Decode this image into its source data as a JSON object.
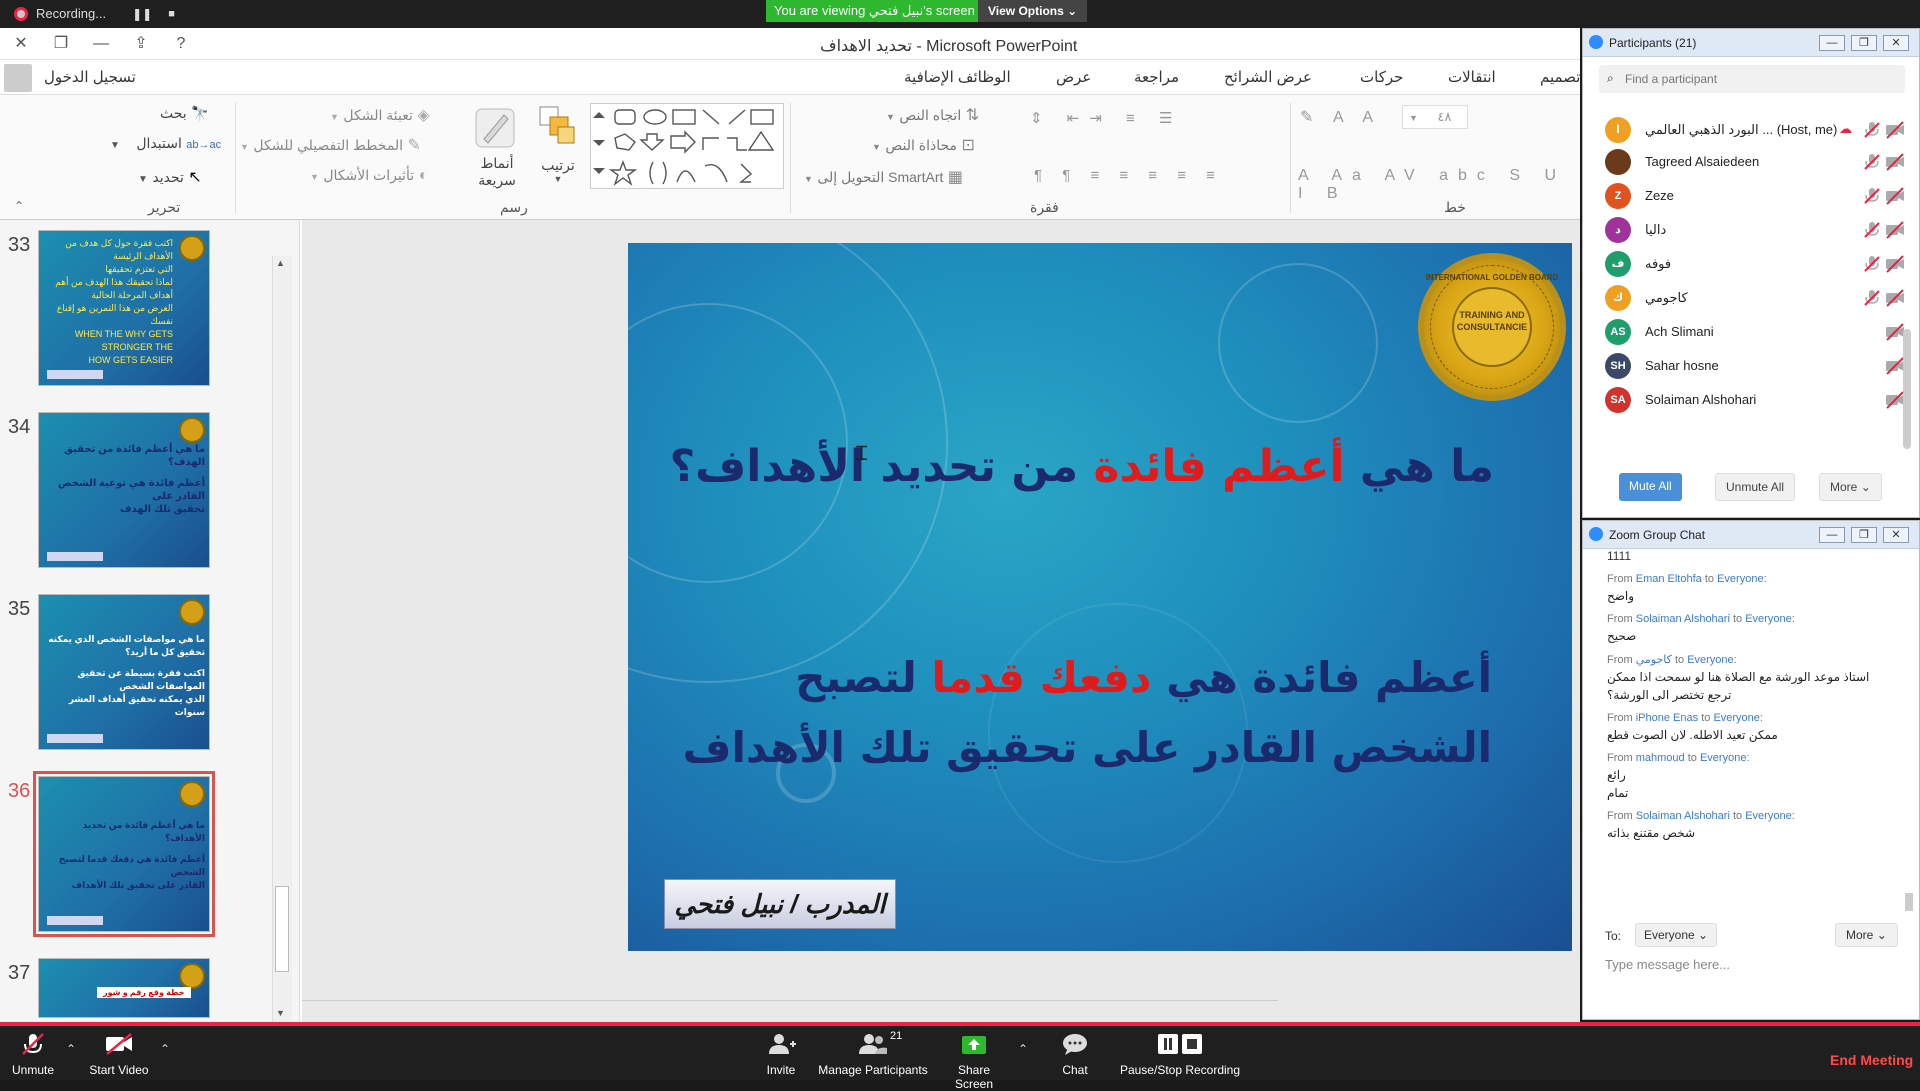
{
  "zoom_top": {
    "recording_label": "Recording...",
    "viewing_banner": "You are viewing نبيل فتحي's screen",
    "view_options": "View Options"
  },
  "ppt": {
    "window_title": "تحديد الاهداف - Microsoft PowerPoint",
    "signin": "تسجيل الدخول",
    "tabs": [
      "تصميم",
      "انتقالات",
      "حركات",
      "عرض الشرائح",
      "مراجعة",
      "عرض",
      "الوظائف الإضافية"
    ],
    "groups": {
      "editing": "تحرير",
      "drawing": "رسم",
      "paragraph": "فقرة",
      "font": "خط"
    },
    "ribbon": {
      "find": "بحث",
      "replace": "استبدال",
      "select": "تحديد",
      "shape_fill": "تعبئة الشكل",
      "shape_outline": "المخطط التفصيلي للشكل",
      "shape_effects": "تأثيرات الأشكال",
      "quick_styles_1": "أنماط",
      "quick_styles_2": "سريعة",
      "arrange": "ترتيب",
      "text_direction": "اتجاه النص",
      "align_text": "محاذاة النص",
      "convert_smartart": "التحويل إلى SmartArt",
      "font_size_value": "٤٨"
    }
  },
  "thumbnails": [
    {
      "num": "33",
      "lines": [
        "اكتب فقرة حول كل هدف من الأهداف الرئيسة",
        "التي تعتزم تحقيقها",
        "لماذا تحقيقك هذا الهدف من أهم",
        "أهداف المرحلة الحالية",
        "",
        "الغرض من هذا التمرين هو إقناع نفسك",
        "WHEN THE WHY GETS STRONGER THE",
        "HOW GETS EASIER"
      ]
    },
    {
      "num": "34",
      "lines": [
        "ما هي أعظم فائدة من تحقيق",
        "الهدف؟",
        "",
        "أعظم فائدة هي توعية الشخص",
        "القادر على",
        "تحقيق تلك الهدف"
      ]
    },
    {
      "num": "35",
      "lines": [
        "ما هي مواصفات الشخص الذي يمكنه",
        "تحقيق كل ما أريد؟",
        "",
        "اكتب فقرة بسيطة عن تحقيق المواصفات الشخص",
        "الذي يمكنه تحقيق أهداف العشر سنوات"
      ]
    },
    {
      "num": "36",
      "lines": [
        "ما هي أعظم فائدة من تحديد الأهداف؟",
        "",
        "أعظم فائدة هي دفعك قدما لتصبح الشخص",
        "القادر على تحقيق تلك الأهداف"
      ]
    },
    {
      "num": "37",
      "lines": [
        "خطة وقع رقم و شور"
      ]
    }
  ],
  "slide": {
    "title_pre": "ما هي ",
    "title_red": "أعظم فائدة",
    "title_post": " من تحديد الأهداف؟",
    "body_pre": "أعظم فائدة هي ",
    "body_red": "دفعك قدما",
    "body_post": " لتصبح الشخص القادر على تحقيق تلك الأهداف",
    "seal_text": "TRAINING AND CONSULTANCIE",
    "seal_ring": "INTERNATIONAL GOLDEN BOARD",
    "trainer": "المدرب / نبيل فتحي"
  },
  "participants": {
    "title": "Participants (21)",
    "search_placeholder": "Find a participant",
    "list": [
      {
        "initials": "ا",
        "name": "البورد الذهبي العالمي ... (Host, me)",
        "color": "#f0a020"
      },
      {
        "initials": "",
        "name": "Tagreed Alsaiedeen",
        "color": "#6b3a1a"
      },
      {
        "initials": "Z",
        "name": "Zeze",
        "color": "#e0531f"
      },
      {
        "initials": "د",
        "name": "داليا",
        "color": "#a0339a"
      },
      {
        "initials": "ف",
        "name": "فوفه",
        "color": "#1f9e6b"
      },
      {
        "initials": "ك",
        "name": "كاجومي",
        "color": "#f0a020"
      },
      {
        "initials": "AS",
        "name": "Ach Slimani",
        "color": "#1f9e6b"
      },
      {
        "initials": "SH",
        "name": "Sahar hosne",
        "color": "#3a4a66"
      },
      {
        "initials": "SA",
        "name": "Solaiman Alshohari",
        "color": "#d0322c"
      }
    ],
    "mute_all": "Mute All",
    "unmute_all": "Unmute All",
    "more": "More"
  },
  "chat": {
    "title": "Zoom Group Chat",
    "partial_top": "1111",
    "messages": [
      {
        "from": "Eman Eltohfa",
        "to": "Everyone",
        "text": [
          "واضح"
        ]
      },
      {
        "from": "Solaiman Alshohari",
        "to": "Everyone",
        "text": [
          "صحيح"
        ]
      },
      {
        "from": "كاجومي",
        "to": "Everyone",
        "text": [
          "استاذ موعد الورشة مع الصلاة هنا لو سمحت اذا ممكن",
          "ترجع تختصر الى الورشة؟"
        ]
      },
      {
        "from": "iPhone Enas",
        "to": "Everyone",
        "text": [
          "ممكن تعيد الاطله. لان الصوت قطع"
        ]
      },
      {
        "from": "mahmoud",
        "to": "Everyone",
        "text": [
          "رائع",
          "تمام"
        ]
      },
      {
        "from": "Solaiman Alshohari",
        "to": "Everyone",
        "text": [
          "شخص مقتنع بذاته"
        ]
      }
    ],
    "from_word": "From",
    "to_word": "to",
    "to_label": "To:",
    "to_value": "Everyone",
    "more": "More",
    "input_placeholder": "Type message here..."
  },
  "zoom_bottom": {
    "unmute": "Unmute",
    "start_video": "Start Video",
    "invite": "Invite",
    "manage_participants": "Manage Participants",
    "participant_count": "21",
    "share_screen": "Share Screen",
    "chat": "Chat",
    "pause_stop_recording": "Pause/Stop Recording",
    "end_meeting": "End Meeting"
  }
}
